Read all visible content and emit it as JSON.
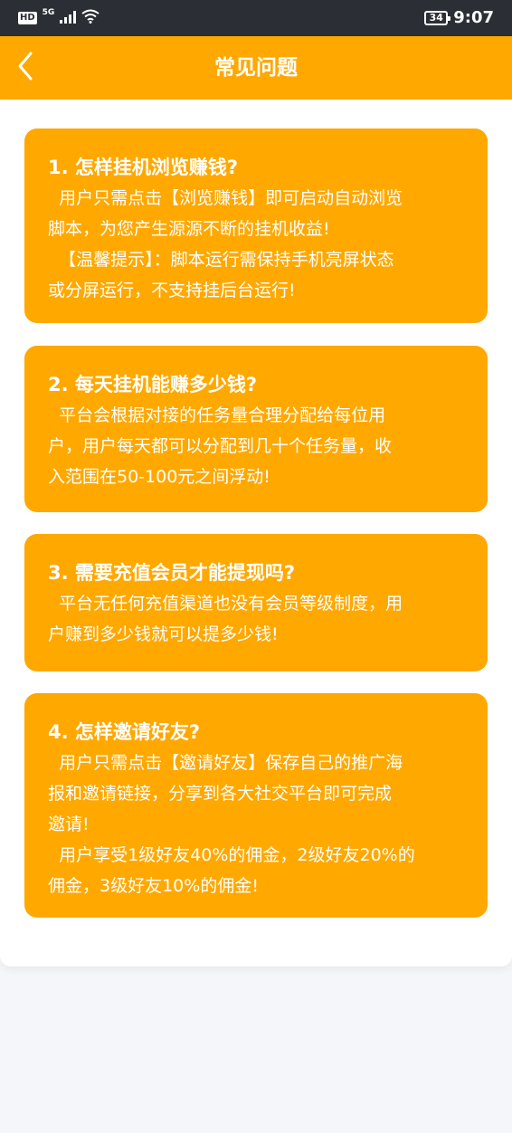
{
  "status_bar": {
    "hd_label": "HD",
    "network_label": "5G",
    "battery_level": "34",
    "time": "9:07"
  },
  "header": {
    "title": "常见问题",
    "back_icon": "chevron-left-icon"
  },
  "colors": {
    "accent": "#ffa800",
    "status_bar_bg": "#2b2e34",
    "text_on_accent": "#ffffff",
    "page_bg": "#f5f6fa"
  },
  "faq": [
    {
      "question": "1. 怎样挂机浏览赚钱?",
      "answer_lines": [
        "  用户只需点击【浏览赚钱】即可启动自动浏览",
        "脚本，为您产生源源不断的挂机收益!",
        "  【温馨提示】：脚本运行需保持手机亮屏状态",
        "或分屏运行，不支持挂后台运行!"
      ]
    },
    {
      "question": "2. 每天挂机能赚多少钱?",
      "answer_lines": [
        "  平台会根据对接的任务量合理分配给每位用",
        "户，用户每天都可以分配到几十个任务量，收",
        "入范围在50-100元之间浮动!"
      ]
    },
    {
      "question": "3. 需要充值会员才能提现吗?",
      "answer_lines": [
        "  平台无任何充值渠道也没有会员等级制度，用",
        "户赚到多少钱就可以提多少钱!"
      ]
    },
    {
      "question": "4. 怎样邀请好友?",
      "answer_lines": [
        "  用户只需点击【邀请好友】保存自己的推广海",
        "报和邀请链接，分享到各大社交平台即可完成",
        "邀请!",
        "  用户享受1级好友40%的佣金，2级好友20%的",
        "佣金，3级好友10%的佣金!"
      ]
    }
  ]
}
